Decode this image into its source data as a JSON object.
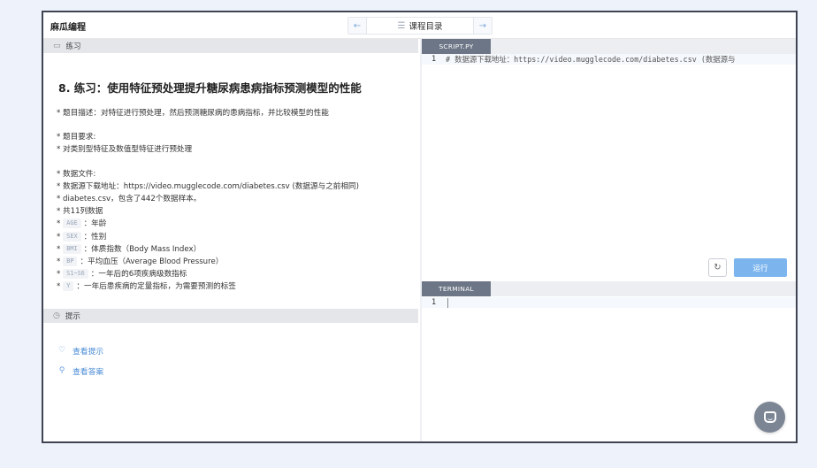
{
  "app": {
    "title": "麻瓜编程"
  },
  "nav": {
    "prev_icon": "arrow-left-icon",
    "menu_icon": "list-icon",
    "label": "课程目录",
    "next_icon": "arrow-right-icon"
  },
  "exercise": {
    "header": "练习",
    "title": "8. 练习：使用特征预处理提升糖尿病患病指标预测模型的性能",
    "lines": [
      {
        "text": "* 题目描述：对特征进行预处理，然后预测糖尿病的患病指标，并比较模型的性能"
      },
      {
        "text": ""
      },
      {
        "text": "* 题目要求:"
      },
      {
        "text": "* 对类别型特征及数值型特征进行预处理"
      },
      {
        "text": ""
      },
      {
        "text": "* 数据文件:"
      },
      {
        "text": "* 数据源下载地址：https://video.mugglecode.com/diabetes.csv (数据源与之前相同)"
      },
      {
        "text": "* diabetes.csv，包含了442个数据样本。"
      },
      {
        "text": "* 共11列数据"
      },
      {
        "prefix": "*",
        "code": "AGE",
        "text": "：年龄"
      },
      {
        "prefix": "*",
        "code": "SEX",
        "text": "：性别"
      },
      {
        "prefix": "*",
        "code": "BMI",
        "text": "：体质指数（Body Mass Index）"
      },
      {
        "prefix": "*",
        "code": "BP",
        "text": "：平均血压（Average Blood Pressure）"
      },
      {
        "prefix": "*",
        "code": "S1~S6",
        "text": "：一年后的6项疾病级数指标"
      },
      {
        "prefix": "*",
        "code": "Y",
        "text": "：一年后患疾病的定量指标，为需要预测的标签"
      }
    ]
  },
  "hint": {
    "header": "提示",
    "links": [
      {
        "label": "查看提示",
        "icon": "lightbulb-icon"
      },
      {
        "label": "查看答案",
        "icon": "key-icon"
      }
    ]
  },
  "editor": {
    "tab": "SCRIPT.PY",
    "line_number": "1",
    "code": "# 数据源下载地址：https://video.mugglecode.com/diabetes.csv (数据源与",
    "run_label": "运行",
    "reset_icon": "refresh-icon"
  },
  "terminal": {
    "tab": "TERMINAL",
    "line_number": "1"
  },
  "colors": {
    "accent": "#7cb5ee",
    "tab": "#6c7686",
    "link": "#4a8bd4",
    "frame": "#3f4452"
  },
  "chat": {
    "icon": "chat-icon"
  }
}
